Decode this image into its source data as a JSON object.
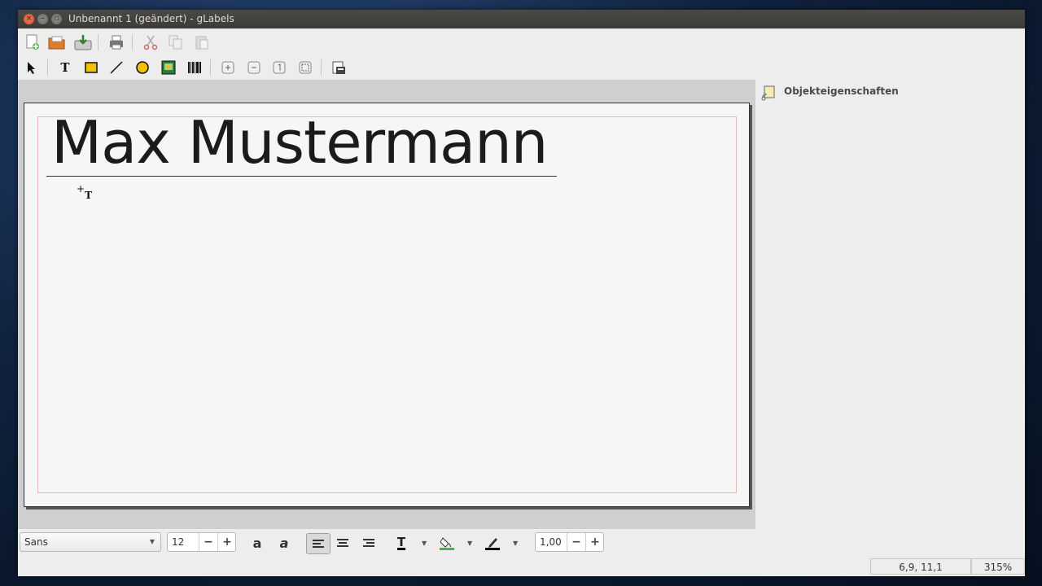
{
  "window": {
    "title": "Unbenannt 1 (geändert) - gLabels"
  },
  "toolbar1": {
    "icons": [
      "new-document-icon",
      "open-folder-icon",
      "save-icon",
      "print-icon",
      "cut-icon",
      "copy-icon",
      "paste-icon"
    ]
  },
  "toolbar2": {
    "icons": [
      "select-arrow-icon",
      "text-tool-icon",
      "box-tool-icon",
      "line-tool-icon",
      "ellipse-tool-icon",
      "image-tool-icon",
      "barcode-tool-icon",
      "zoom-in-icon",
      "zoom-out-icon",
      "zoom-1to1-icon",
      "zoom-fit-icon",
      "merge-properties-icon"
    ]
  },
  "label": {
    "text": "Max Mustermann"
  },
  "props": {
    "title": "Objekteigenschaften"
  },
  "format_bar": {
    "font_family": "Sans",
    "font_size": "12",
    "line_spacing": "1,00",
    "text_color": "#000000",
    "fill_color": "#4caf50",
    "line_color": "#000000"
  },
  "status": {
    "cursor_pos": "6,9, 11,1",
    "zoom": "315%"
  }
}
